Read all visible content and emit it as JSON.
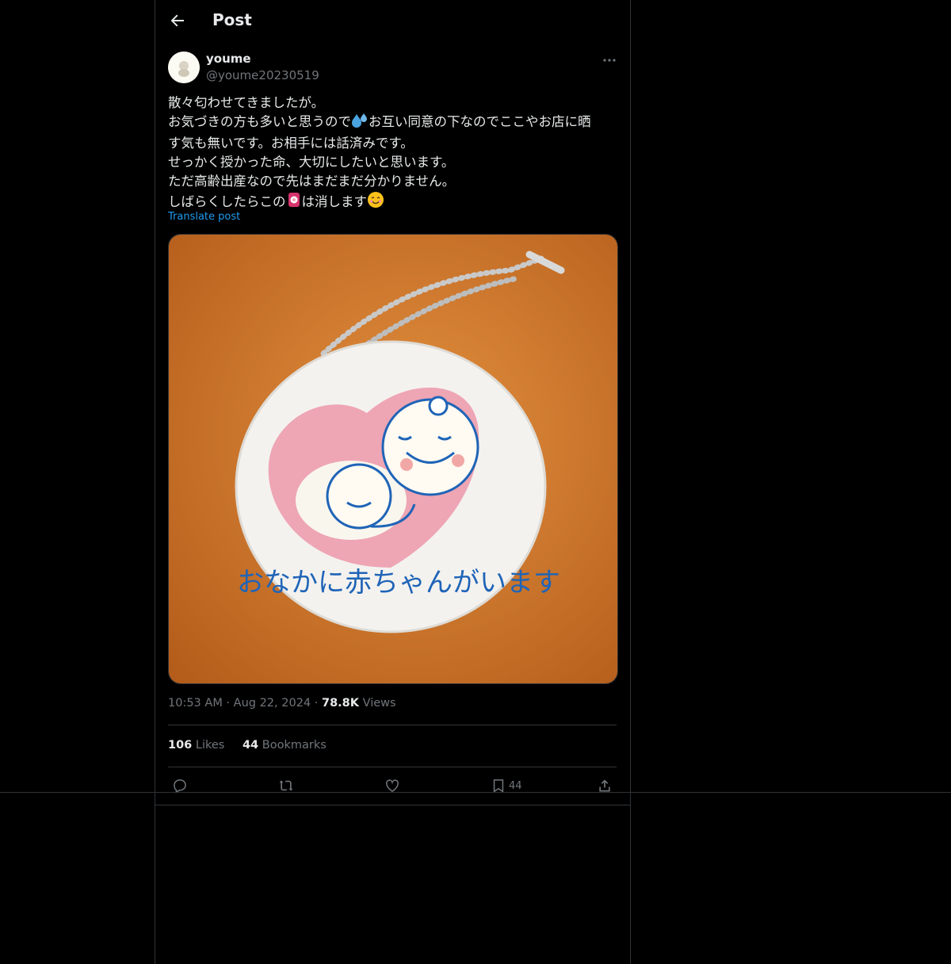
{
  "header": {
    "title": "Post"
  },
  "author": {
    "display_name": "youme",
    "handle": "@youme20230519"
  },
  "post": {
    "line1": "散々匂わせてきましたが。",
    "line2a": "お気づきの方も多いと思うので",
    "line2b": "お互い同意の下なのでここやお店に晒",
    "line3": "す気も無いです。お相手には話済みです。",
    "line4": "せっかく授かった命、大切にしたいと思います。",
    "line5": "ただ高齢出産なので先はまだまだ分かりません。",
    "line6a": "しばらくしたらこの",
    "line6b": "は消します",
    "translate": "Translate post"
  },
  "media": {
    "tag_text": "おなかに赤ちゃんがいます"
  },
  "meta": {
    "time": "10:53 AM",
    "dot": "·",
    "date": "Aug 22, 2024",
    "views_count": "78.8K",
    "views_label": "Views"
  },
  "stats": {
    "likes_count": "106",
    "likes_label": "Likes",
    "bookmarks_count": "44",
    "bookmarks_label": "Bookmarks"
  },
  "actions": {
    "bookmark_count": "44"
  },
  "icons": [
    "back-arrow-icon",
    "more-icon",
    "sweat-droplets-emoji",
    "badge-emoji",
    "smiling-face-emoji",
    "reply-icon",
    "repost-icon",
    "like-icon",
    "bookmark-icon",
    "share-icon"
  ],
  "colors": {
    "background": "#000000",
    "text": "#e7e9ea",
    "muted": "#71767b",
    "link": "#1d9bf0",
    "border": "#2f3336"
  }
}
